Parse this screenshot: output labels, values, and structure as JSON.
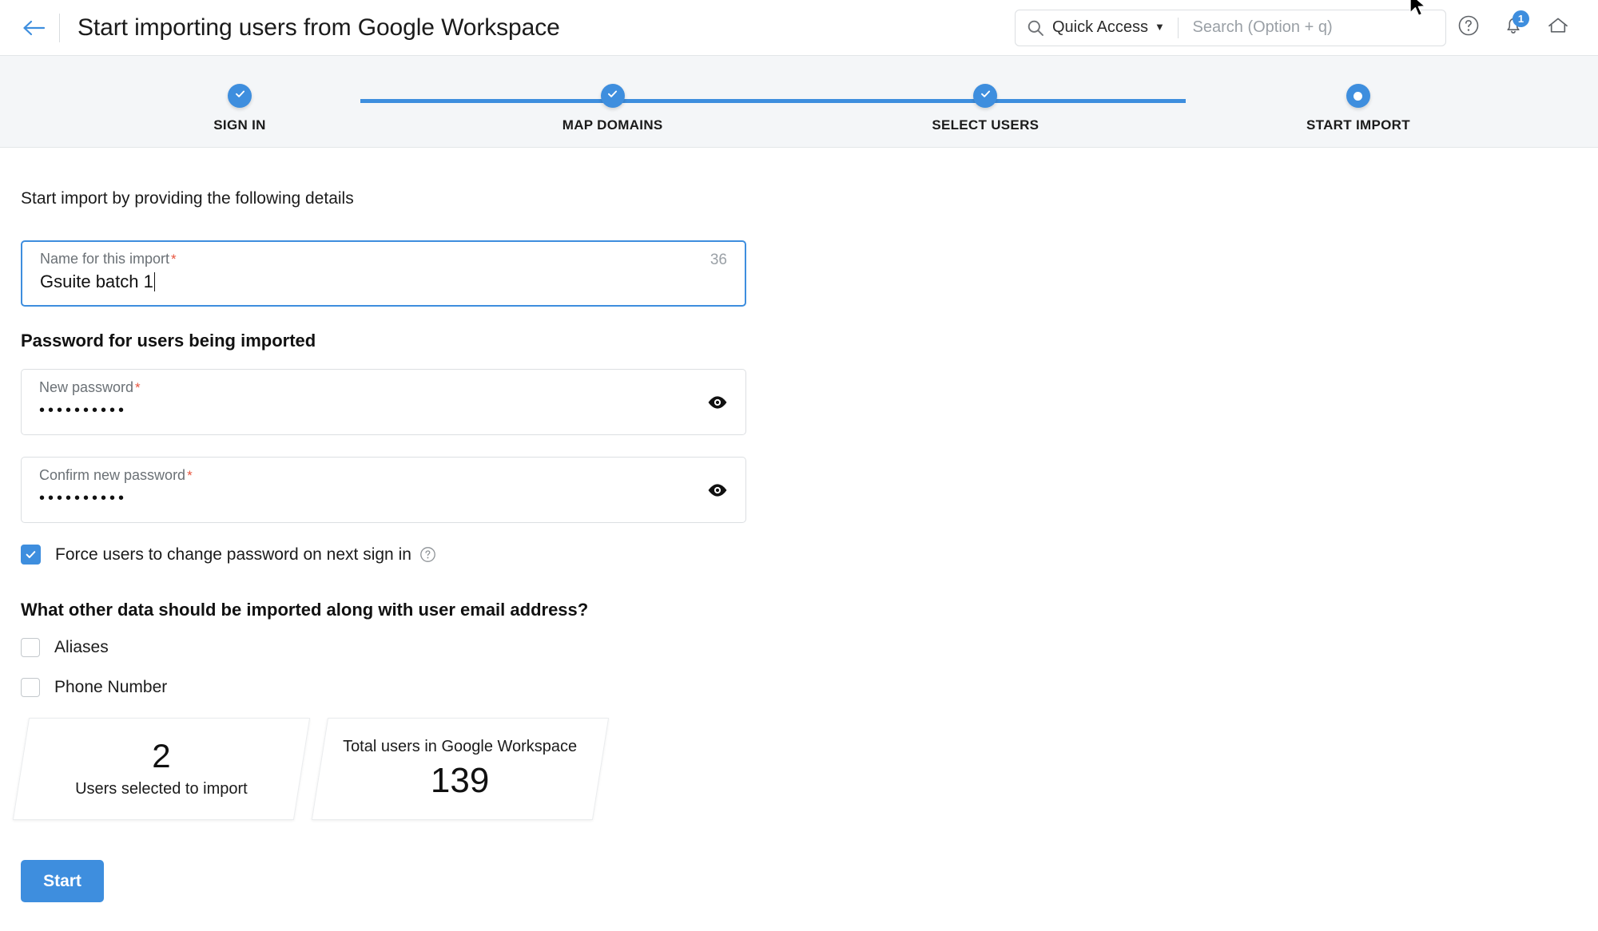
{
  "header": {
    "back_icon": "arrow-left-icon",
    "title": "Start importing users from Google Workspace",
    "search": {
      "icon": "search-icon",
      "scope_label": "Quick Access",
      "caret": "▼",
      "placeholder": "Search (Option + q)",
      "value": ""
    },
    "help_icon": "question-circle-icon",
    "notifications": {
      "icon": "bell-icon",
      "badge_count": "1",
      "badge_color": "#3e8ede"
    },
    "home_icon": "home-icon"
  },
  "stepper": {
    "accent_color": "#3e8ede",
    "steps": [
      {
        "label": "SIGN IN",
        "state": "complete",
        "glyph": "check-icon"
      },
      {
        "label": "MAP DOMAINS",
        "state": "complete",
        "glyph": "check-icon"
      },
      {
        "label": "SELECT USERS",
        "state": "complete",
        "glyph": "check-icon"
      },
      {
        "label": "START IMPORT",
        "state": "current",
        "glyph": "dot"
      }
    ]
  },
  "main": {
    "intro": "Start import by providing the following details",
    "import_name": {
      "label": "Name for this import",
      "required_mark": "*",
      "value": "Gsuite batch 1",
      "char_counter": "36"
    },
    "password_section": {
      "heading": "Password for users being imported",
      "new_password": {
        "label": "New password",
        "required_mark": "*",
        "masked_value": "••••••••••",
        "toggle_icon": "eye-icon"
      },
      "confirm_password": {
        "label": "Confirm new password",
        "required_mark": "*",
        "masked_value": "••••••••••",
        "toggle_icon": "eye-icon"
      },
      "force_change": {
        "label": "Force users to change password on next sign in",
        "checked": true,
        "help_icon": "question-circle-icon"
      }
    },
    "other_data": {
      "heading": "What other data should be imported along with user email address?",
      "options": [
        {
          "label": "Aliases",
          "checked": false
        },
        {
          "label": "Phone Number",
          "checked": false
        }
      ]
    },
    "stats": [
      {
        "value": "2",
        "caption": "Users selected to import",
        "caption_position": "bottom"
      },
      {
        "value": "139",
        "caption": "Total users in Google Workspace",
        "caption_position": "top"
      }
    ],
    "start_button": "Start"
  }
}
